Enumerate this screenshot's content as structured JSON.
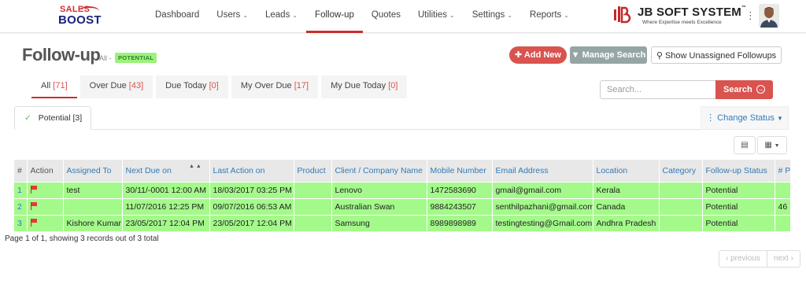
{
  "logo": {
    "line1": "SALES",
    "line2": "BOOST"
  },
  "nav": {
    "items": [
      {
        "label": "Dashboard",
        "dropdown": false
      },
      {
        "label": "Users",
        "dropdown": true
      },
      {
        "label": "Leads",
        "dropdown": true
      },
      {
        "label": "Follow-up",
        "dropdown": false,
        "active": true
      },
      {
        "label": "Quotes",
        "dropdown": false
      },
      {
        "label": "Utilities",
        "dropdown": true
      },
      {
        "label": "Settings",
        "dropdown": true
      },
      {
        "label": "Reports",
        "dropdown": true
      }
    ],
    "caret": "⌄"
  },
  "brand": {
    "name": "JB SOFT SYSTEM",
    "tm": "™",
    "tagline": "Where Expertise meets Excellence"
  },
  "page": {
    "title": "Follow-up",
    "filter_prefix": "All -",
    "badge": "POTENTIAL"
  },
  "actions": {
    "add_new": "Add New",
    "manage_search": "Manage Search",
    "show_unassigned": "Show Unassigned Followups"
  },
  "tabs": [
    {
      "label": "All",
      "count": "[71]",
      "active": true
    },
    {
      "label": "Over Due",
      "count": "[43]"
    },
    {
      "label": "Due Today",
      "count": "[0]"
    },
    {
      "label": "My Over Due",
      "count": "[17]"
    },
    {
      "label": "My Due Today",
      "count": "[0]"
    }
  ],
  "search": {
    "placeholder": "Search...",
    "button": "Search"
  },
  "subtab": {
    "label": "Potential [3]"
  },
  "change_status": "Change Status",
  "table": {
    "columns": [
      "#",
      "Action",
      "Assigned To",
      "Next Due on",
      "Last Action on",
      "Product",
      "Client / Company Name",
      "Mobile Number",
      "Email Address",
      "Location",
      "Category",
      "Follow-up Status",
      "# Pb"
    ],
    "rows": [
      {
        "n": "1",
        "assigned": "test",
        "next_due": "30/11/-0001 12:00 AM",
        "last_action": "18/03/2017 03:25 PM",
        "product": "",
        "client": "Lenovo",
        "mobile": "1472583690",
        "email": "gmail@gmail.com",
        "location": "Kerala",
        "category": "",
        "status": "Potential",
        "pb": ""
      },
      {
        "n": "2",
        "assigned": "",
        "next_due": "11/07/2016 12:25 PM",
        "last_action": "09/07/2016 06:53 AM",
        "product": "",
        "client": "Australian Swan",
        "mobile": "9884243507",
        "email": "senthilpazhani@gmail.com",
        "location": "Canada",
        "category": "",
        "status": "Potential",
        "pb": "46"
      },
      {
        "n": "3",
        "assigned": "Kishore Kumar",
        "next_due": "23/05/2017 12:04 PM",
        "last_action": "23/05/2017 12:04 PM",
        "product": "",
        "client": "Samsung",
        "mobile": "8989898989",
        "email": "testingtesting@Gmail.com",
        "location": "Andhra Pradesh",
        "category": "",
        "status": "Potential",
        "pb": ""
      }
    ]
  },
  "pagination": {
    "summary": "Page 1 of 1, showing 3 records out of 3 total",
    "previous": "‹ previous",
    "next": "next ›"
  },
  "colors": {
    "accent": "#d9534f",
    "row_highlight": "#a4f98b",
    "link": "#337ab7"
  }
}
